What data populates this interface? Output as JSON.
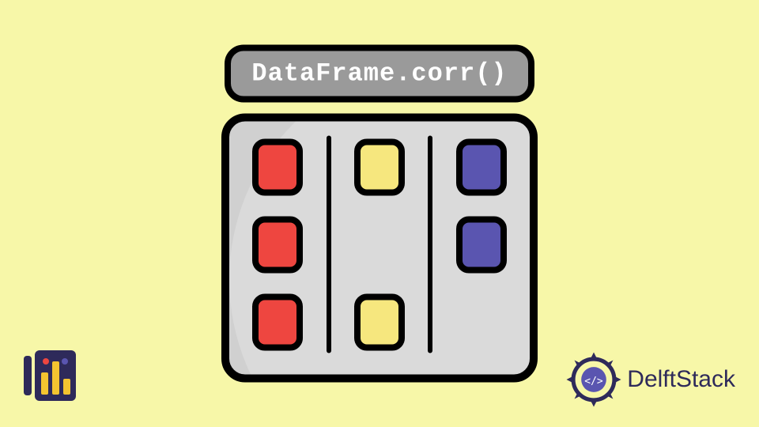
{
  "title": "DataFrame.corr()",
  "columns": [
    {
      "cells": [
        "red",
        "red",
        "red"
      ]
    },
    {
      "cells": [
        "yellow",
        "empty",
        "yellow"
      ]
    },
    {
      "cells": [
        "blue",
        "blue",
        "empty"
      ]
    }
  ],
  "brand": {
    "name": "DelftStack"
  }
}
